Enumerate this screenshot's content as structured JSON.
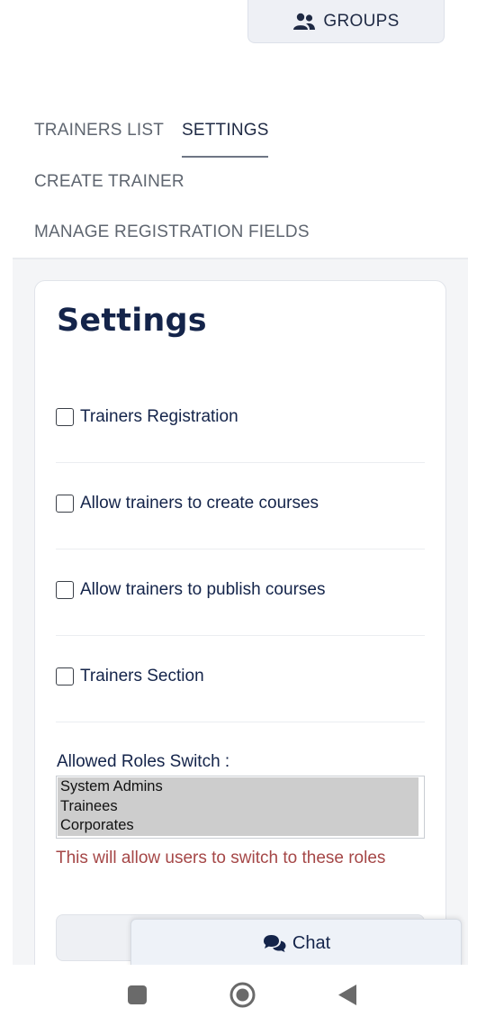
{
  "header": {
    "groups_button": {
      "label": "GROUPS",
      "icon": "users-icon"
    }
  },
  "nav": {
    "tabs": [
      {
        "label": "TRAINERS LIST",
        "active": false
      },
      {
        "label": "SETTINGS",
        "active": true
      },
      {
        "label": "CREATE TRAINER",
        "active": false
      },
      {
        "label": "MANAGE REGISTRATION FIELDS",
        "active": false
      }
    ]
  },
  "settings": {
    "title": "Settings",
    "options": [
      {
        "label": "Trainers Registration",
        "checked": false
      },
      {
        "label": "Allow trainers to create courses",
        "checked": false
      },
      {
        "label": "Allow trainers to publish courses",
        "checked": false
      },
      {
        "label": "Trainers Section",
        "checked": false
      }
    ],
    "roles": {
      "label": "Allowed Roles Switch :",
      "options": [
        "System Admins",
        "Trainees",
        "Corporates"
      ],
      "hint": "This will allow users to switch to these roles"
    }
  },
  "chat": {
    "label": "Chat",
    "icon": "chat-bubbles-icon"
  },
  "system_nav": {
    "recents_icon": "square-icon",
    "home_icon": "circle-home-icon",
    "back_icon": "triangle-back-icon"
  },
  "colors": {
    "title": "#14244a",
    "hint": "#a54747",
    "selected_option": "#cdcdcd",
    "content_bg": "#f4f5f7"
  }
}
